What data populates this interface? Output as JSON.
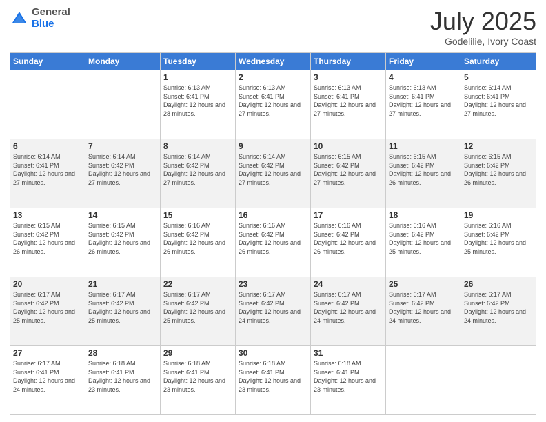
{
  "header": {
    "logo_line1": "General",
    "logo_line2": "Blue",
    "month_title": "July 2025",
    "location": "Godelilie, Ivory Coast"
  },
  "days_of_week": [
    "Sunday",
    "Monday",
    "Tuesday",
    "Wednesday",
    "Thursday",
    "Friday",
    "Saturday"
  ],
  "weeks": [
    [
      {
        "day": "",
        "info": ""
      },
      {
        "day": "",
        "info": ""
      },
      {
        "day": "1",
        "info": "Sunrise: 6:13 AM\nSunset: 6:41 PM\nDaylight: 12 hours and 28 minutes."
      },
      {
        "day": "2",
        "info": "Sunrise: 6:13 AM\nSunset: 6:41 PM\nDaylight: 12 hours and 27 minutes."
      },
      {
        "day": "3",
        "info": "Sunrise: 6:13 AM\nSunset: 6:41 PM\nDaylight: 12 hours and 27 minutes."
      },
      {
        "day": "4",
        "info": "Sunrise: 6:13 AM\nSunset: 6:41 PM\nDaylight: 12 hours and 27 minutes."
      },
      {
        "day": "5",
        "info": "Sunrise: 6:14 AM\nSunset: 6:41 PM\nDaylight: 12 hours and 27 minutes."
      }
    ],
    [
      {
        "day": "6",
        "info": "Sunrise: 6:14 AM\nSunset: 6:41 PM\nDaylight: 12 hours and 27 minutes."
      },
      {
        "day": "7",
        "info": "Sunrise: 6:14 AM\nSunset: 6:42 PM\nDaylight: 12 hours and 27 minutes."
      },
      {
        "day": "8",
        "info": "Sunrise: 6:14 AM\nSunset: 6:42 PM\nDaylight: 12 hours and 27 minutes."
      },
      {
        "day": "9",
        "info": "Sunrise: 6:14 AM\nSunset: 6:42 PM\nDaylight: 12 hours and 27 minutes."
      },
      {
        "day": "10",
        "info": "Sunrise: 6:15 AM\nSunset: 6:42 PM\nDaylight: 12 hours and 27 minutes."
      },
      {
        "day": "11",
        "info": "Sunrise: 6:15 AM\nSunset: 6:42 PM\nDaylight: 12 hours and 26 minutes."
      },
      {
        "day": "12",
        "info": "Sunrise: 6:15 AM\nSunset: 6:42 PM\nDaylight: 12 hours and 26 minutes."
      }
    ],
    [
      {
        "day": "13",
        "info": "Sunrise: 6:15 AM\nSunset: 6:42 PM\nDaylight: 12 hours and 26 minutes."
      },
      {
        "day": "14",
        "info": "Sunrise: 6:15 AM\nSunset: 6:42 PM\nDaylight: 12 hours and 26 minutes."
      },
      {
        "day": "15",
        "info": "Sunrise: 6:16 AM\nSunset: 6:42 PM\nDaylight: 12 hours and 26 minutes."
      },
      {
        "day": "16",
        "info": "Sunrise: 6:16 AM\nSunset: 6:42 PM\nDaylight: 12 hours and 26 minutes."
      },
      {
        "day": "17",
        "info": "Sunrise: 6:16 AM\nSunset: 6:42 PM\nDaylight: 12 hours and 26 minutes."
      },
      {
        "day": "18",
        "info": "Sunrise: 6:16 AM\nSunset: 6:42 PM\nDaylight: 12 hours and 25 minutes."
      },
      {
        "day": "19",
        "info": "Sunrise: 6:16 AM\nSunset: 6:42 PM\nDaylight: 12 hours and 25 minutes."
      }
    ],
    [
      {
        "day": "20",
        "info": "Sunrise: 6:17 AM\nSunset: 6:42 PM\nDaylight: 12 hours and 25 minutes."
      },
      {
        "day": "21",
        "info": "Sunrise: 6:17 AM\nSunset: 6:42 PM\nDaylight: 12 hours and 25 minutes."
      },
      {
        "day": "22",
        "info": "Sunrise: 6:17 AM\nSunset: 6:42 PM\nDaylight: 12 hours and 25 minutes."
      },
      {
        "day": "23",
        "info": "Sunrise: 6:17 AM\nSunset: 6:42 PM\nDaylight: 12 hours and 24 minutes."
      },
      {
        "day": "24",
        "info": "Sunrise: 6:17 AM\nSunset: 6:42 PM\nDaylight: 12 hours and 24 minutes."
      },
      {
        "day": "25",
        "info": "Sunrise: 6:17 AM\nSunset: 6:42 PM\nDaylight: 12 hours and 24 minutes."
      },
      {
        "day": "26",
        "info": "Sunrise: 6:17 AM\nSunset: 6:42 PM\nDaylight: 12 hours and 24 minutes."
      }
    ],
    [
      {
        "day": "27",
        "info": "Sunrise: 6:17 AM\nSunset: 6:41 PM\nDaylight: 12 hours and 24 minutes."
      },
      {
        "day": "28",
        "info": "Sunrise: 6:18 AM\nSunset: 6:41 PM\nDaylight: 12 hours and 23 minutes."
      },
      {
        "day": "29",
        "info": "Sunrise: 6:18 AM\nSunset: 6:41 PM\nDaylight: 12 hours and 23 minutes."
      },
      {
        "day": "30",
        "info": "Sunrise: 6:18 AM\nSunset: 6:41 PM\nDaylight: 12 hours and 23 minutes."
      },
      {
        "day": "31",
        "info": "Sunrise: 6:18 AM\nSunset: 6:41 PM\nDaylight: 12 hours and 23 minutes."
      },
      {
        "day": "",
        "info": ""
      },
      {
        "day": "",
        "info": ""
      }
    ]
  ]
}
